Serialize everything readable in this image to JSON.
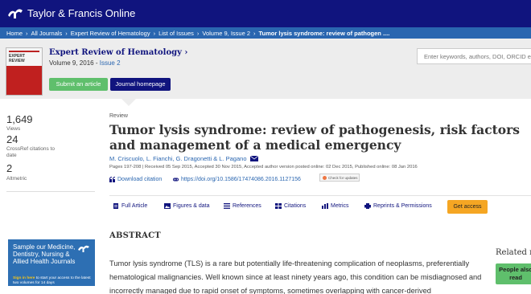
{
  "header": {
    "brand_text": "Taylor & Francis Online"
  },
  "breadcrumb": {
    "items": [
      "Home",
      "All Journals",
      "Expert Review of Hematology",
      "List of Issues",
      "Volume 9, Issue 2",
      "Tumor lysis syndrome: review of pathogen ...."
    ]
  },
  "journal": {
    "cover_title": "EXPERT REVIEW",
    "title": "Expert Review of Hematology ›",
    "volume": "Volume 9, 2016 -",
    "issue": "Issue 2",
    "submit_label": "Submit an article",
    "homepage_label": "Journal homepage"
  },
  "search": {
    "placeholder": "Enter keywords, authors, DOI, ORCID etc"
  },
  "metrics": [
    {
      "value": "1,649",
      "label": "Views"
    },
    {
      "value": "24",
      "label": "CrossRef citations to date"
    },
    {
      "value": "2",
      "label": "Altmetric"
    }
  ],
  "article": {
    "type": "Review",
    "title": "Tumor lysis syndrome: review of pathogenesis, risk factors and management of a medical emergency",
    "authors": "M. Criscuolo, L. Fianchi, G. Dragonetti & L. Pagano",
    "history": "Pages 197-208 | Received 05 Sep 2015, Accepted 30 Nov 2015, Accepted author version posted online: 02 Dec 2015, Published online: 08 Jan 2016",
    "download_citation": "Download citation",
    "doi": "https://doi.org/10.1586/17474086.2016.1127156",
    "check_updates": "Check for updates"
  },
  "tabs": {
    "full_article": "Full Article",
    "figures": "Figures & data",
    "references": "References",
    "citations": "Citations",
    "metrics": "Metrics",
    "reprints": "Reprints & Permissions",
    "get_access": "Get access"
  },
  "abstract": {
    "heading": "ABSTRACT",
    "text": "Tumor lysis syndrome (TLS) is a rare but potentially life-threatening complication of neoplasms, preferentially hematological malignancies. Well known since at least ninety years ago, this condition can be misdiagnosed and incorrectly managed due to rapid onset of symptoms, sometimes overlapping with cancer-derived"
  },
  "ad": {
    "headline": "Sample our Medicine, Dentistry, Nursing & Allied Health Journals",
    "footer_bold": "Sign in here",
    "footer_text": "to start your access to the latest two volumes for 14 days"
  },
  "related": {
    "heading": "Related r",
    "button": "People also read"
  },
  "colors": {
    "navy": "#10147e",
    "blue": "#2a66b0",
    "green": "#5fbf6c",
    "orange": "#f5a623"
  }
}
